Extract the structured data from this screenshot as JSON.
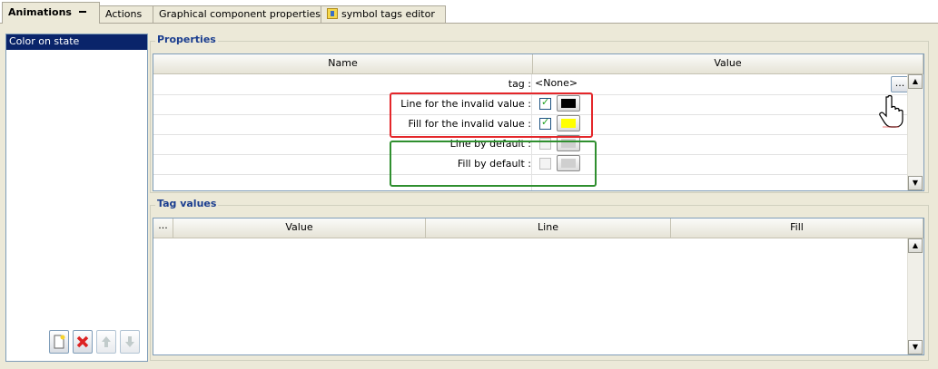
{
  "tabs": [
    {
      "label": "Animations",
      "active": true
    },
    {
      "label": "Actions"
    },
    {
      "label": "Graphical component properties"
    },
    {
      "label": "symbol tags editor",
      "icon": "tag-editor-icon"
    }
  ],
  "left_panel": {
    "items": [
      "Color on state"
    ],
    "buttons": [
      {
        "name": "add-button",
        "icon": "new-page-icon"
      },
      {
        "name": "delete-button",
        "icon": "red-x-icon"
      },
      {
        "name": "move-up-button",
        "icon": "arrow-up-icon"
      },
      {
        "name": "move-down-button",
        "icon": "arrow-down-icon"
      }
    ]
  },
  "properties": {
    "title": "Properties",
    "columns": {
      "name": "Name",
      "value": "Value"
    },
    "rows": [
      {
        "name": "tag :",
        "value_text": "<None>",
        "has_ellipsis": true
      },
      {
        "name": "Line for the invalid value :",
        "checked": true,
        "color": "#000000"
      },
      {
        "name": "Fill for the invalid value :",
        "checked": true,
        "color": "#ffff00"
      },
      {
        "name": "Line by default :",
        "checked": false,
        "disabled": true,
        "color": "#cfcfcf"
      },
      {
        "name": "Fill by default :",
        "checked": false,
        "disabled": true,
        "color": "#cfcfcf"
      }
    ],
    "ellipsis": "..."
  },
  "tag_values": {
    "title": "Tag values",
    "columns": {
      "menu": "...",
      "value": "Value",
      "line": "Line",
      "fill": "Fill"
    }
  },
  "colors": {
    "highlight_red": "#e4262a",
    "highlight_green": "#2f8f2f",
    "selection": "#0a246a"
  }
}
